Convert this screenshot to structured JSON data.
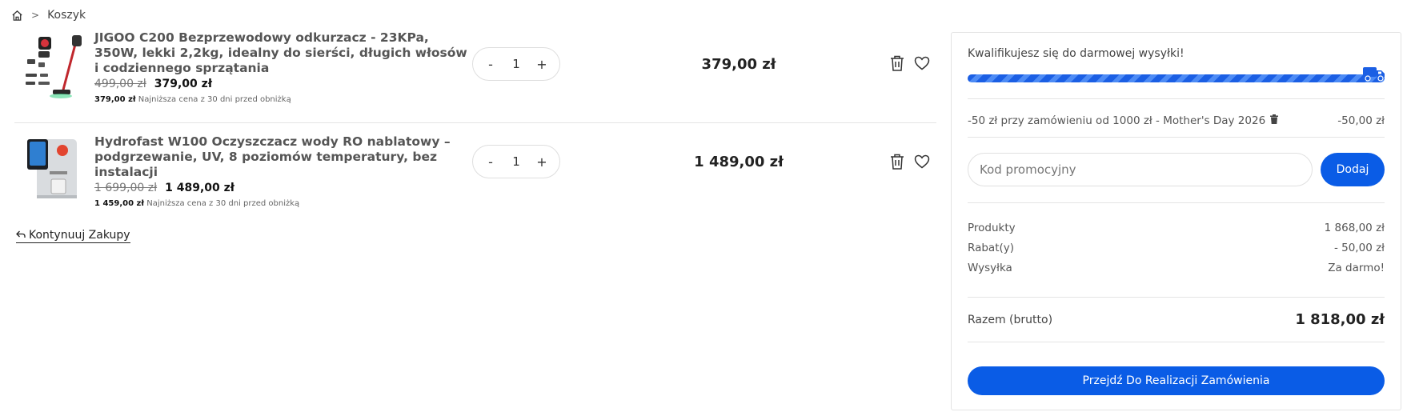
{
  "breadcrumb": {
    "home_icon": "home-icon",
    "separator": ">",
    "current": "Koszyk"
  },
  "cart": {
    "items": [
      {
        "name": "JIGOO C200 Bezprzewodowy odkurzacz - 23KPa, 350W, lekki 2,2kg, idealny do sierści, długich włosów i codziennego sprzątania",
        "old_price": "499,00 zł",
        "price": "379,00 zł",
        "lowest_price": "379,00 zł",
        "lowest_label": "Najniższa cena z 30 dni przed obniżką",
        "quantity": "1",
        "minus": "-",
        "plus": "+",
        "total": "379,00 zł",
        "image_icon": "vacuum-cleaner-image"
      },
      {
        "name": "Hydrofast W100 Oczyszczacz wody RO nablatowy – podgrzewanie, UV, 8 poziomów temperatury, bez instalacji",
        "old_price": "1 699,00 zł",
        "price": "1 489,00 zł",
        "lowest_price": "1 459,00 zł",
        "lowest_label": "Najniższa cena z 30 dni przed obniżką",
        "quantity": "1",
        "minus": "-",
        "plus": "+",
        "total": "1 489,00 zł",
        "image_icon": "water-purifier-image"
      }
    ],
    "continue_label": "Kontynuuj Zakupy"
  },
  "summary": {
    "free_shipping_text": "Kwalifikujesz się do darmowej wysyłki!",
    "free_shipping_progress": 1.0,
    "discount_name": "-50 zł przy zamówieniu od 1000 zł - Mother's Day 2026",
    "discount_value": "-50,00 zł",
    "promo_placeholder": "Kod promocyjny",
    "promo_button": "Dodaj",
    "rows": [
      {
        "label": "Produkty",
        "value": "1 868,00 zł"
      },
      {
        "label": "Rabat(y)",
        "value": "- 50,00 zł"
      },
      {
        "label": "Wysyłka",
        "value": "Za darmo!"
      }
    ],
    "total_label": "Razem (brutto)",
    "total_value": "1 818,00 zł",
    "checkout_label": "Przejdź Do Realizacji Zamówienia"
  },
  "colors": {
    "accent": "#0a5ce6",
    "text": "#222222",
    "muted": "#555555",
    "border": "#e3e3e3"
  }
}
